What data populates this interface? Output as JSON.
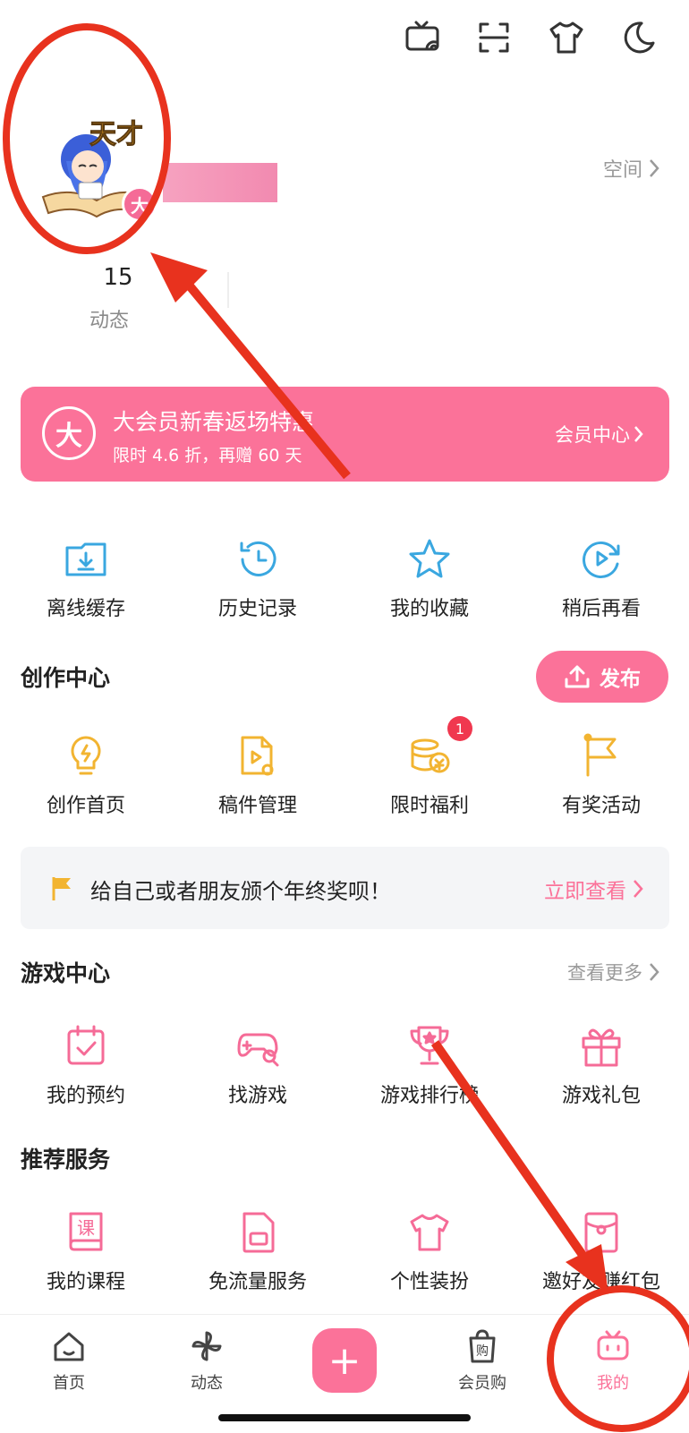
{
  "top_icons": [
    "tv-icon",
    "scan-icon",
    "shirt-icon",
    "moon-icon"
  ],
  "profile": {
    "space_label": "空间",
    "stat_value": "15",
    "stat_label": "动态",
    "avatar_badge": "大",
    "avatar_text": "天才"
  },
  "vip_banner": {
    "badge": "大",
    "title": "大会员新春返场特惠",
    "subtitle": "限时 4.6 折，再赠 60 天",
    "link": "会员中心"
  },
  "quick_actions": [
    {
      "label": "离线缓存",
      "icon": "folder-download-icon"
    },
    {
      "label": "历史记录",
      "icon": "history-clock-icon"
    },
    {
      "label": "我的收藏",
      "icon": "star-icon"
    },
    {
      "label": "稍后再看",
      "icon": "play-later-icon"
    }
  ],
  "creation": {
    "title": "创作中心",
    "publish_label": "发布",
    "items": [
      {
        "label": "创作首页",
        "icon": "lightbulb-icon"
      },
      {
        "label": "稿件管理",
        "icon": "file-video-icon"
      },
      {
        "label": "限时福利",
        "icon": "coins-icon",
        "badge": "1"
      },
      {
        "label": "有奖活动",
        "icon": "flag-icon"
      }
    ]
  },
  "notice": {
    "text": "给自己或者朋友颁个年终奖呗！",
    "link": "立即查看"
  },
  "game_center": {
    "title": "游戏中心",
    "more": "查看更多",
    "items": [
      {
        "label": "我的预约",
        "icon": "calendar-check-icon"
      },
      {
        "label": "找游戏",
        "icon": "gamepad-search-icon"
      },
      {
        "label": "游戏排行榜",
        "icon": "trophy-icon"
      },
      {
        "label": "游戏礼包",
        "icon": "gift-icon"
      }
    ]
  },
  "services": {
    "title": "推荐服务",
    "items": [
      {
        "label": "我的课程",
        "icon": "course-book-icon",
        "glyph": "课"
      },
      {
        "label": "免流量服务",
        "icon": "sim-card-icon"
      },
      {
        "label": "个性装扮",
        "icon": "shirt-outline-icon"
      },
      {
        "label": "邀好友赚红包",
        "icon": "red-packet-icon"
      }
    ]
  },
  "bottom_nav": [
    {
      "label": "首页",
      "icon": "home-icon"
    },
    {
      "label": "动态",
      "icon": "pinwheel-icon"
    },
    {
      "label": "+",
      "icon": "plus-icon"
    },
    {
      "label": "会员购",
      "icon": "shopping-bag-icon",
      "glyph": "购"
    },
    {
      "label": "我的",
      "icon": "tv-face-icon"
    }
  ],
  "colors": {
    "accent": "#fb7299",
    "annotation_red": "#e8321e",
    "creation_icons": "#f2b431",
    "quick_icons": "#3aa7e0",
    "service_icons": "#f56b97"
  }
}
